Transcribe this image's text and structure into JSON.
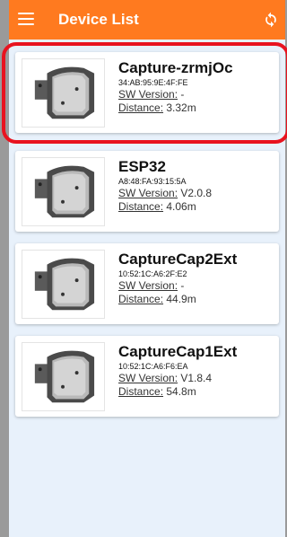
{
  "header": {
    "title": "Device List",
    "menu_icon": "hamburger-menu-icon",
    "refresh_icon": "refresh-icon"
  },
  "labels": {
    "sw_version": "SW Version:",
    "distance": "Distance:"
  },
  "devices": [
    {
      "name": "Capture-zrmjOc",
      "mac": "34:AB:95:9E:4F:FE",
      "sw_version": "-",
      "distance": "3.32m"
    },
    {
      "name": "ESP32",
      "mac": "A8:48:FA:93:15:5A",
      "sw_version": "V2.0.8",
      "distance": "4.06m"
    },
    {
      "name": "CaptureCap2Ext",
      "mac": "10:52:1C:A6:2F:E2",
      "sw_version": "-",
      "distance": "44.9m"
    },
    {
      "name": "CaptureCap1Ext",
      "mac": "10:52:1C:A6:F6:EA",
      "sw_version": "V1.8.4",
      "distance": "54.8m"
    }
  ],
  "colors": {
    "header_bg": "#ff7a1f",
    "list_bg": "#e8f1fb",
    "highlight": "#e8131f"
  }
}
